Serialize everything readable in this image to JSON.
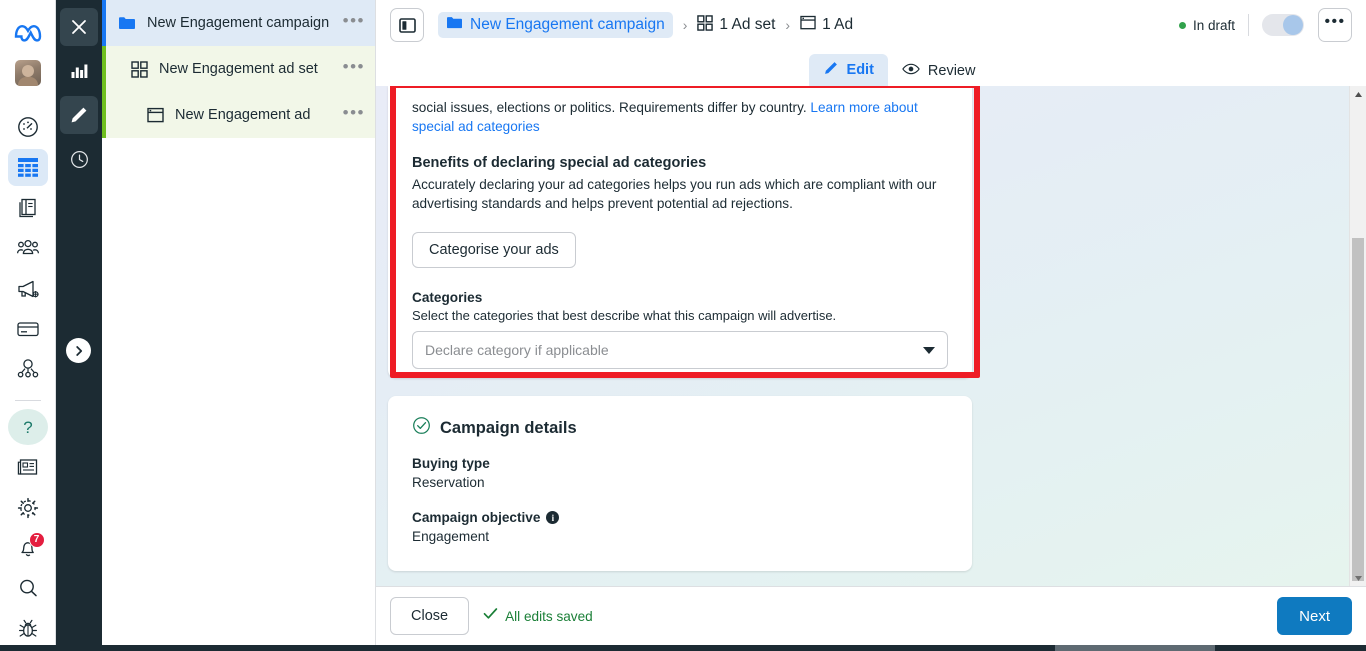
{
  "brand": {
    "logo": "meta-logo",
    "accent": "#1877f2"
  },
  "left_rail": {
    "items": [
      {
        "name": "meta-logo",
        "icon": "meta-infinity-logo",
        "active": false
      },
      {
        "name": "user-avatar",
        "icon": "avatar",
        "active": false
      },
      {
        "name": "performance",
        "icon": "speedometer-icon",
        "active": false
      },
      {
        "name": "campaigns-table",
        "icon": "table-grid-icon",
        "active": true
      },
      {
        "name": "library",
        "icon": "books-icon",
        "active": false
      },
      {
        "name": "audiences",
        "icon": "people-group-icon",
        "active": false
      },
      {
        "name": "ads-reporting",
        "icon": "megaphone-icon",
        "active": false
      },
      {
        "name": "billing",
        "icon": "credit-card-icon",
        "active": false
      },
      {
        "name": "events-manager",
        "icon": "network-nodes-icon",
        "active": false
      },
      {
        "name": "help",
        "icon": "question-mark-icon",
        "active": false
      },
      {
        "name": "news",
        "icon": "newspaper-icon",
        "active": false
      },
      {
        "name": "settings",
        "icon": "gear-icon",
        "active": false
      },
      {
        "name": "notifications",
        "icon": "bell-icon",
        "badge": "7",
        "active": false
      },
      {
        "name": "search",
        "icon": "magnifier-icon",
        "active": false
      },
      {
        "name": "debug",
        "icon": "bug-icon",
        "active": false
      }
    ],
    "notifications_badge": "7"
  },
  "dark_rail": {
    "items": [
      {
        "name": "close",
        "icon": "x-close-icon",
        "selected": true
      },
      {
        "name": "insights",
        "icon": "bar-chart-icon",
        "selected": false
      },
      {
        "name": "edit",
        "icon": "pencil-icon",
        "selected": true
      },
      {
        "name": "history",
        "icon": "clock-icon",
        "selected": false
      }
    ],
    "expand_icon": "chevron-right-icon"
  },
  "tree": {
    "items": [
      {
        "label": "New Engagement campaign",
        "icon": "folder-icon",
        "level": 0,
        "state": "campaign",
        "menu": "•••"
      },
      {
        "label": "New Engagement ad set",
        "icon": "grid-squares-icon",
        "level": 1,
        "state": "adset",
        "menu": "•••"
      },
      {
        "label": "New Engagement ad",
        "icon": "ad-frame-icon",
        "level": 2,
        "state": "ad",
        "menu": "•••"
      }
    ]
  },
  "topbar": {
    "panel_toggle_icon": "side-panel-icon",
    "breadcrumb": [
      {
        "label": "New Engagement campaign",
        "icon": "folder-icon",
        "active": true
      },
      {
        "label": "1 Ad set",
        "icon": "grid-squares-icon",
        "active": false
      },
      {
        "label": "1 Ad",
        "icon": "ad-frame-icon",
        "active": false
      }
    ],
    "separator": "›",
    "status": "In draft",
    "status_color": "#31a24c",
    "toggle_on": false,
    "more_label": "•••"
  },
  "tabs": [
    {
      "label": "Edit",
      "icon": "pencil-icon",
      "active": true
    },
    {
      "label": "Review",
      "icon": "eye-icon",
      "active": false
    }
  ],
  "special_ad_categories": {
    "intro_text": "social issues, elections or politics. Requirements differ by country. ",
    "intro_link": "Learn more about special ad categories",
    "benefits_heading": "Benefits of declaring special ad categories",
    "benefits_text": "Accurately declaring your ad categories helps you run ads which are compliant with our advertising standards and helps prevent potential ad rejections.",
    "categorise_button": "Categorise your ads",
    "categories_label": "Categories",
    "categories_desc": "Select the categories that best describe what this campaign will advertise.",
    "categories_placeholder": "Declare category if applicable"
  },
  "campaign_details": {
    "title": "Campaign details",
    "status_icon": "check-circle-icon",
    "fields": [
      {
        "label": "Buying type",
        "value": "Reservation",
        "info": false
      },
      {
        "label": "Campaign objective",
        "value": "Engagement",
        "info": true
      }
    ]
  },
  "footer": {
    "close_label": "Close",
    "saved_label": "All edits saved",
    "saved_icon": "check-icon",
    "next_label": "Next"
  },
  "highlight": {
    "color": "#ee1c25"
  }
}
